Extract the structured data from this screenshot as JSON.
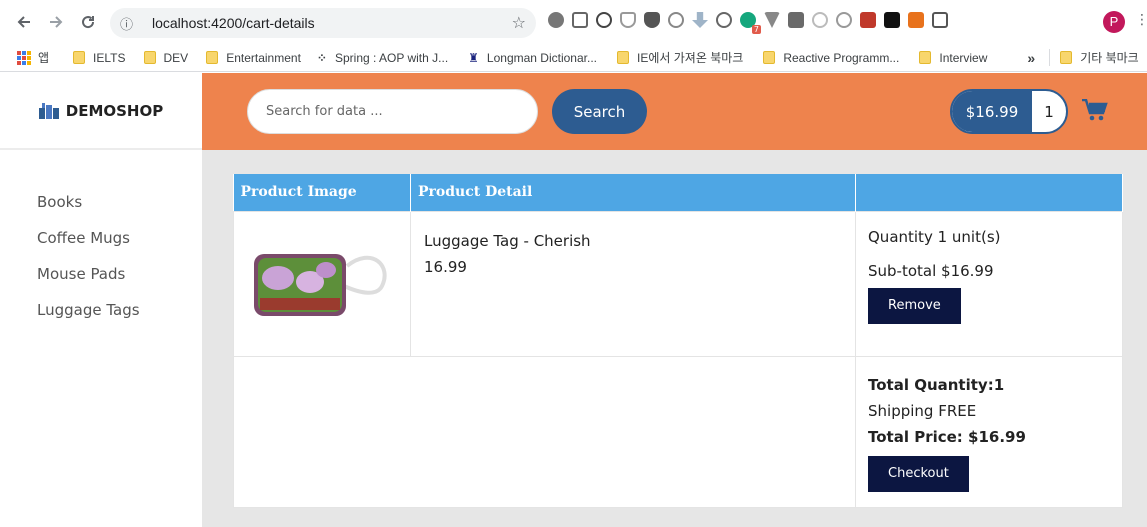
{
  "browser": {
    "url": "localhost:4200/cart-details",
    "profile_initial": "P",
    "extension_badge": "7",
    "bookmarks": [
      {
        "label": "앱",
        "type": "apps"
      },
      {
        "label": "IELTS",
        "type": "folder"
      },
      {
        "label": "DEV",
        "type": "folder"
      },
      {
        "label": "Entertainment",
        "type": "folder"
      },
      {
        "label": "Spring : AOP with J...",
        "type": "link"
      },
      {
        "label": "Longman Dictionar...",
        "type": "link"
      },
      {
        "label": "IE에서 가져온 북마크",
        "type": "folder"
      },
      {
        "label": "Reactive Programm...",
        "type": "folder"
      },
      {
        "label": "Interview",
        "type": "folder"
      }
    ],
    "bookmarks_overflow": "»",
    "other_bookmarks": "기타 북마크"
  },
  "app": {
    "brand": "DEMOSHOP",
    "search": {
      "placeholder": "Search for data ...",
      "button": "Search"
    },
    "cart": {
      "price": "$16.99",
      "count": "1"
    },
    "categories": [
      "Books",
      "Coffee Mugs",
      "Mouse Pads",
      "Luggage Tags"
    ],
    "table": {
      "headers": [
        "Product Image",
        "Product Detail",
        ""
      ],
      "item": {
        "name": "Luggage Tag - Cherish",
        "price": "16.99",
        "quantity": "Quantity 1 unit(s)",
        "subtotal": "Sub-total $16.99",
        "remove": "Remove"
      },
      "summary": {
        "total_quantity": "Total Quantity:1",
        "shipping": "Shipping FREE",
        "total_price": "Total Price: $16.99",
        "checkout": "Checkout"
      }
    }
  },
  "colors": {
    "header": "#ee834d",
    "primary": "#2d5c91",
    "table_header": "#4ea6e4",
    "dark_button": "#0c1641"
  }
}
